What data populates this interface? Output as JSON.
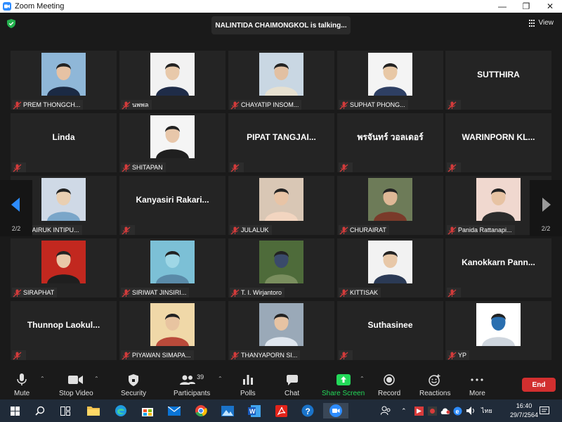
{
  "window": {
    "title": "Zoom Meeting",
    "minimize": "—",
    "maximize": "❐",
    "close": "✕"
  },
  "meeting": {
    "talking_banner": "NALINTIDA CHAIMONGKOL is talking...",
    "view_label": "View",
    "page_indicator_left": "2/2",
    "page_indicator_right": "2/2"
  },
  "participants": [
    {
      "name": "PREM THONGCH...",
      "video": true
    },
    {
      "name": "นพพล",
      "video": true
    },
    {
      "name": "CHAYATIP INSOM...",
      "video": true
    },
    {
      "name": "SUPHAT PHONG...",
      "video": true
    },
    {
      "name": "",
      "big": "SUTTHIRA",
      "video": false
    },
    {
      "name": "",
      "big": "Linda",
      "video": false
    },
    {
      "name": "SHITAPAN",
      "video": true
    },
    {
      "name": "",
      "big": "PIPAT TANGJAI...",
      "video": false
    },
    {
      "name": "",
      "big": "พรจันทร์ วอลเดอร์",
      "video": false
    },
    {
      "name": "",
      "big": "WARINPORN KL...",
      "video": false
    },
    {
      "name": "PHAIRUK INTIPU...",
      "video": true
    },
    {
      "name": "",
      "big": "Kanyasiri Rakari...",
      "video": false
    },
    {
      "name": "JULALUK",
      "video": true
    },
    {
      "name": "CHURAIRAT",
      "video": true
    },
    {
      "name": "Panida Rattanapi...",
      "video": true
    },
    {
      "name": "SIRAPHAT",
      "video": true
    },
    {
      "name": "SIRIWAT JINSIRI...",
      "video": true
    },
    {
      "name": "T. I. Wirjantoro",
      "video": true
    },
    {
      "name": "KITTISAK",
      "video": true
    },
    {
      "name": "",
      "big": "Kanokkarn Pann...",
      "video": false
    },
    {
      "name": "",
      "big": "Thunnop Laokul...",
      "video": false
    },
    {
      "name": "PIYAWAN SIMAPA...",
      "video": true
    },
    {
      "name": "THANYAPORN SI...",
      "video": true
    },
    {
      "name": "",
      "big": "Suthasinee",
      "video": false
    },
    {
      "name": "YP",
      "video": true
    }
  ],
  "toolbar": {
    "mute": "Mute",
    "stop_video": "Stop Video",
    "security": "Security",
    "participants": "Participants",
    "participants_count": "39",
    "polls": "Polls",
    "chat": "Chat",
    "share_screen": "Share Screen",
    "record": "Record",
    "reactions": "Reactions",
    "more": "More",
    "end": "End",
    "share_color": "#23d959",
    "end_color": "#d22f2f"
  },
  "taskbar": {
    "language": "ไทย",
    "time": "16:40",
    "date": "29/7/2564"
  }
}
